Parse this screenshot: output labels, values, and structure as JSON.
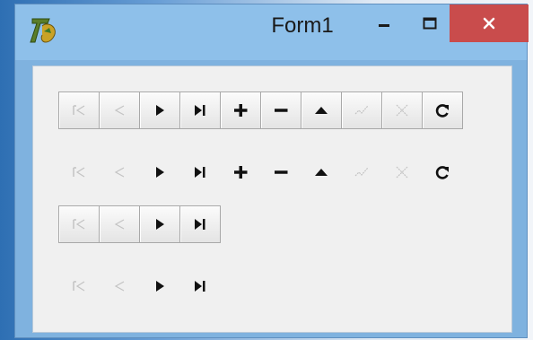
{
  "window": {
    "title": "Form1"
  },
  "colors": {
    "close_button": "#c94c4c",
    "titlebar": "#8ec0ea",
    "client": "#f0f0f0"
  },
  "navigators": [
    {
      "style": "framed",
      "buttons": [
        {
          "name": "first",
          "enabled": false
        },
        {
          "name": "prior",
          "enabled": false
        },
        {
          "name": "next",
          "enabled": true
        },
        {
          "name": "last",
          "enabled": true
        },
        {
          "name": "insert",
          "enabled": true
        },
        {
          "name": "delete",
          "enabled": true
        },
        {
          "name": "edit",
          "enabled": true
        },
        {
          "name": "post",
          "enabled": false
        },
        {
          "name": "cancel",
          "enabled": false
        },
        {
          "name": "refresh",
          "enabled": true
        }
      ]
    },
    {
      "style": "flat",
      "buttons": [
        {
          "name": "first",
          "enabled": false
        },
        {
          "name": "prior",
          "enabled": false
        },
        {
          "name": "next",
          "enabled": true
        },
        {
          "name": "last",
          "enabled": true
        },
        {
          "name": "insert",
          "enabled": true
        },
        {
          "name": "delete",
          "enabled": true
        },
        {
          "name": "edit",
          "enabled": true
        },
        {
          "name": "post",
          "enabled": false
        },
        {
          "name": "cancel",
          "enabled": false
        },
        {
          "name": "refresh",
          "enabled": true
        }
      ]
    },
    {
      "style": "framed",
      "buttons": [
        {
          "name": "first",
          "enabled": false
        },
        {
          "name": "prior",
          "enabled": false
        },
        {
          "name": "next",
          "enabled": true
        },
        {
          "name": "last",
          "enabled": true
        }
      ]
    },
    {
      "style": "flat",
      "buttons": [
        {
          "name": "first",
          "enabled": false
        },
        {
          "name": "prior",
          "enabled": false
        },
        {
          "name": "next",
          "enabled": true
        },
        {
          "name": "last",
          "enabled": true
        }
      ]
    }
  ]
}
